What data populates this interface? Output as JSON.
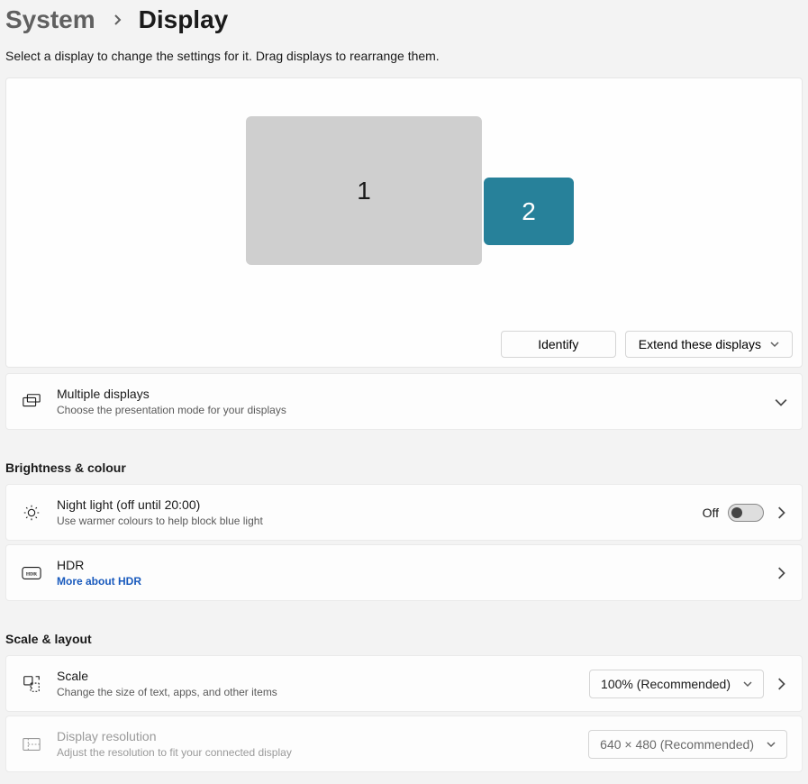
{
  "breadcrumb": {
    "parent": "System",
    "current": "Display"
  },
  "subtitle": "Select a display to change the settings for it. Drag displays to rearrange them.",
  "arrange": {
    "monitor1": "1",
    "monitor2": "2",
    "identify": "Identify",
    "extend_mode": "Extend these displays"
  },
  "rows": {
    "multiple": {
      "title": "Multiple displays",
      "desc": "Choose the presentation mode for your displays"
    },
    "night": {
      "title": "Night light (off until 20:00)",
      "desc": "Use warmer colours to help block blue light",
      "state_label": "Off"
    },
    "hdr": {
      "title": "HDR",
      "link": "More about HDR"
    },
    "scale": {
      "title": "Scale",
      "desc": "Change the size of text, apps, and other items",
      "value": "100% (Recommended)"
    },
    "resolution": {
      "title": "Display resolution",
      "desc": "Adjust the resolution to fit your connected display",
      "value": "640 × 480 (Recommended)"
    }
  },
  "headings": {
    "brightness": "Brightness & colour",
    "scale": "Scale & layout"
  }
}
